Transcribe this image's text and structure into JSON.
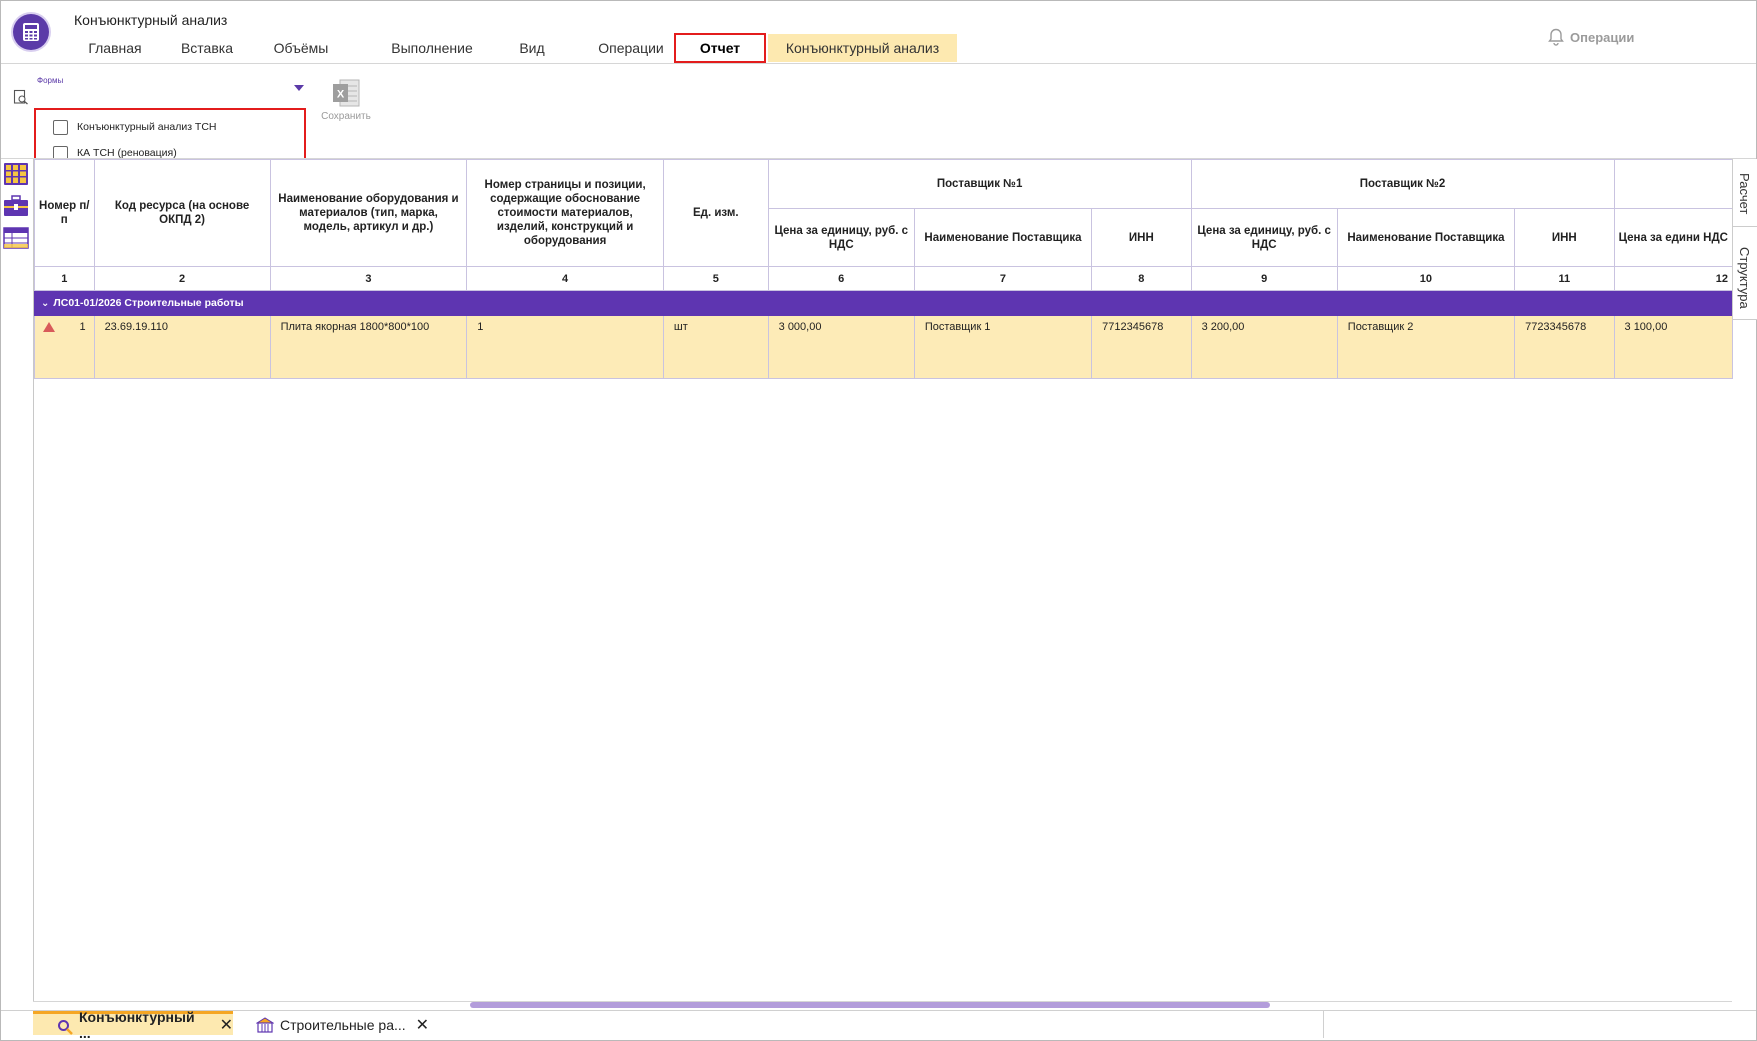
{
  "app": {
    "title": "Конъюнктурный анализ"
  },
  "tabs": [
    {
      "label": "Главная"
    },
    {
      "label": "Вставка"
    },
    {
      "label": "Объёмы"
    },
    {
      "label": "Выполнение"
    },
    {
      "label": "Вид"
    },
    {
      "label": "Операции"
    },
    {
      "label": "Отчет",
      "active": true
    },
    {
      "label": "Конъюнктурный анализ",
      "context": true
    }
  ],
  "notifications": {
    "label": "Операции",
    "icon": "bell-icon"
  },
  "ribbon": {
    "forms_label": "Формы",
    "forms_items": [
      {
        "label": "Конъюнктурный анализ ТСН",
        "checked": false
      },
      {
        "label": "КА ТСН (реновация)",
        "checked": false
      }
    ],
    "save_label": "Сохранить"
  },
  "table": {
    "headers": {
      "num": "Номер п/п",
      "code": "Код ресурса (на основе ОКПД 2)",
      "name": "Наименование оборудования и материалов (тип, марка, модель, артикул и др.)",
      "page": "Номер страницы и позиции, содержащие обоснование стоимости материалов, изделий, конструкций и оборудования",
      "unit": "Ед. изм.",
      "supplier1": "Поставщик №1",
      "supplier2": "Поставщик №2",
      "price": "Цена за единицу, руб. с НДС",
      "supplier_name": "Наименование Поставщика",
      "inn": "ИНН",
      "price12": "Цена за едини НДС"
    },
    "col_numbers": [
      "1",
      "2",
      "3",
      "4",
      "5",
      "6",
      "7",
      "8",
      "9",
      "10",
      "11",
      "12"
    ],
    "group": {
      "label": "ЛС01-01/2026 Строительные работы"
    },
    "rows": [
      {
        "num": "1",
        "code": "23.69.19.110",
        "name": "Плита якорная 1800*800*100",
        "page": "1",
        "unit": "шт",
        "price1": "3 000,00",
        "supplier1": "Поставщик 1",
        "inn1": "7712345678",
        "price2": "3 200,00",
        "supplier2": "Поставщик 2",
        "inn2": "7723345678",
        "price3": "3 100,00"
      }
    ]
  },
  "side_tabs": {
    "calc": "Расчет",
    "structure": "Структура"
  },
  "bottom_tabs": [
    {
      "label": "Конъюнктурный ...",
      "active": true,
      "icon": "search-icon"
    },
    {
      "label": "Строительные ра...",
      "active": false,
      "icon": "building-icon"
    }
  ],
  "colors": {
    "accent": "#5e35b1",
    "row_highlight": "#fdebb7",
    "context_tab": "#fde9b0",
    "highlight_box": "#e31c1c"
  }
}
